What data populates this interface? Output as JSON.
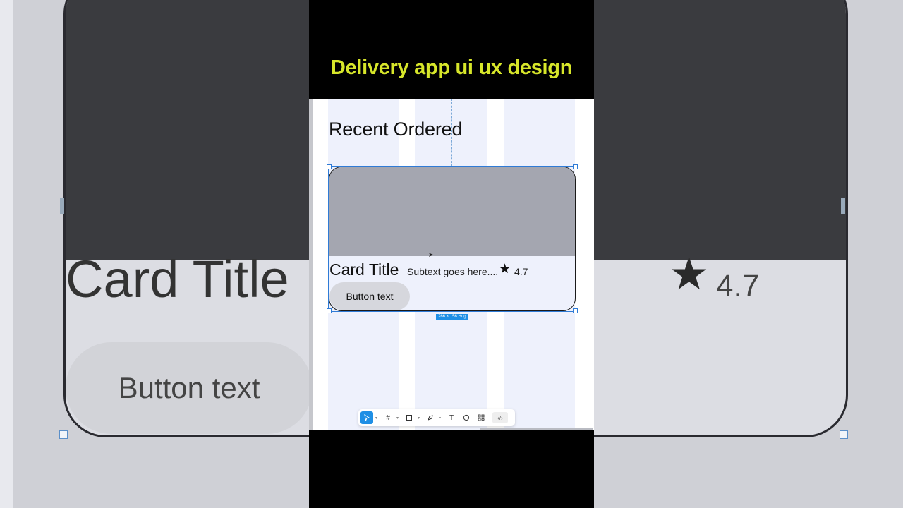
{
  "headline": "Delivery app ui ux design",
  "canvas": {
    "page_title": "Recent Ordered",
    "card": {
      "title": "Card Title",
      "subtext": "Subtext goes here....",
      "rating": "4.7",
      "button_label": "Button text"
    },
    "selection_size_label": "266 × 156 Hug"
  },
  "toolbar": {
    "tools": [
      {
        "name": "move-tool",
        "icon": "pointer-icon",
        "active": true
      },
      {
        "name": "frame-tool",
        "icon": "frame-icon"
      },
      {
        "name": "shape-tool",
        "icon": "rectangle-icon"
      },
      {
        "name": "pen-tool",
        "icon": "pen-icon"
      },
      {
        "name": "text-tool",
        "icon": "text-icon"
      },
      {
        "name": "comment-tool",
        "icon": "comment-icon"
      },
      {
        "name": "components-tool",
        "icon": "components-icon"
      },
      {
        "name": "dev-mode-tool",
        "icon": "code-icon"
      }
    ]
  },
  "background_zoom": {
    "title": "Card Title",
    "button_label": "Button text",
    "rating": "4.7"
  },
  "colors": {
    "headline": "#d7e62a",
    "selection": "#2f7bd6",
    "card_image": "#a4a6b0",
    "layout_grid": "#eef1fc"
  }
}
